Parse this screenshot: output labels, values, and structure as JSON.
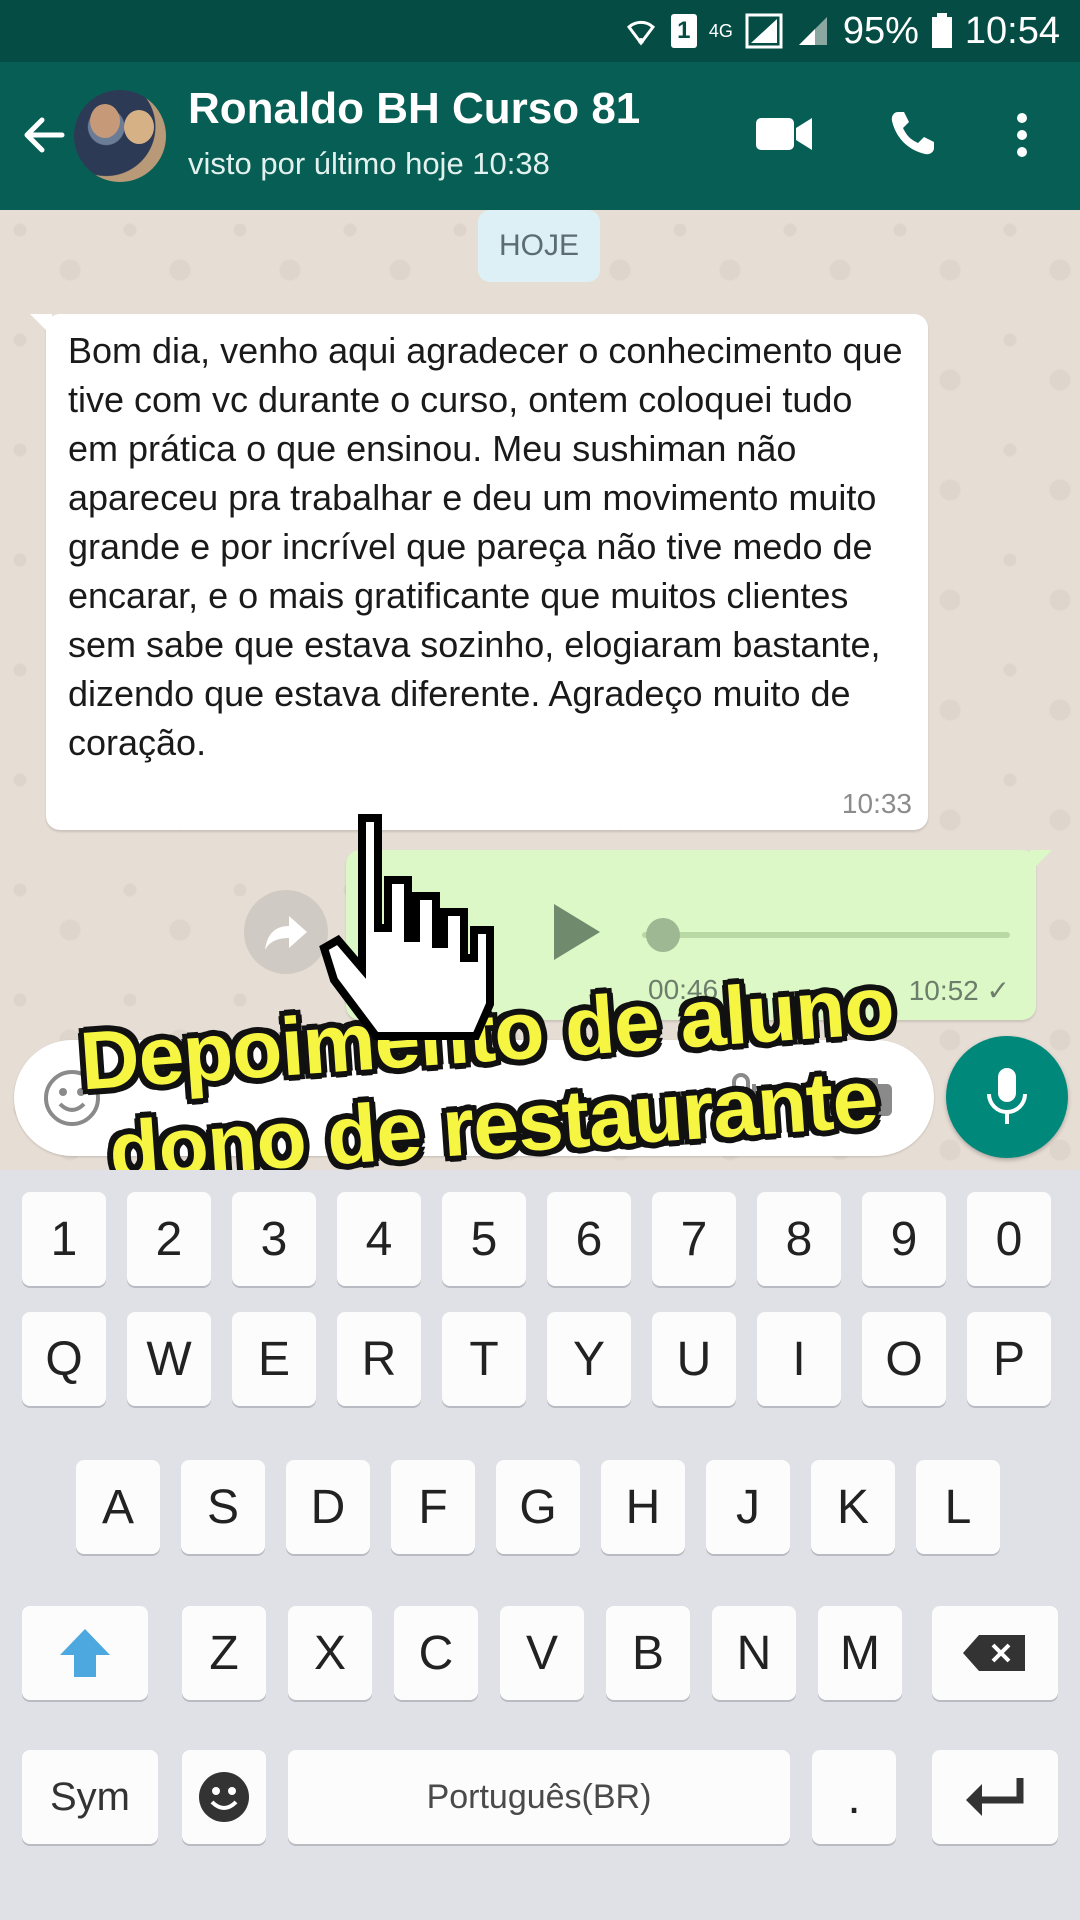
{
  "status_bar": {
    "network": "4G",
    "sim": "1",
    "battery": "95%",
    "time": "10:54"
  },
  "header": {
    "contact_name": "Ronaldo BH Curso 81",
    "last_seen": "visto por último hoje 10:38"
  },
  "chat": {
    "date_label": "HOJE",
    "incoming_message": {
      "text": "Bom dia, venho aqui agradecer o conhecimento que tive com vc durante o curso, ontem coloquei tudo em prática o que ensinou. Meu sushiman não apareceu pra trabalhar e deu um movimento muito grande e por incrível que pareça não tive medo de encarar, e o mais gratificante que muitos clientes sem sabe que estava sozinho, elogiaram bastante, dizendo que estava diferente. Agradeço muito de coração.",
      "time": "10:33"
    },
    "audio_message": {
      "duration": "00:46",
      "time": "10:52 ✓",
      "progress": 0
    }
  },
  "overlay_caption": {
    "line1": "Depoimento de aluno",
    "line2": "dono de restaurante"
  },
  "keyboard": {
    "row_numbers": [
      "1",
      "2",
      "3",
      "4",
      "5",
      "6",
      "7",
      "8",
      "9",
      "0"
    ],
    "row_q": [
      "Q",
      "W",
      "E",
      "R",
      "T",
      "Y",
      "U",
      "I",
      "O",
      "P"
    ],
    "row_a": [
      "A",
      "S",
      "D",
      "F",
      "G",
      "H",
      "J",
      "K",
      "L"
    ],
    "row_z": [
      "Z",
      "X",
      "C",
      "V",
      "B",
      "N",
      "M"
    ],
    "sym_label": "Sym",
    "space_label": "Português(BR)",
    "period_label": "."
  },
  "colors": {
    "header": "#075e54",
    "status_bar": "#054d44",
    "outgoing_bubble": "#dcf8c6",
    "mic_button": "#00897b",
    "caption": "#f5f542"
  }
}
